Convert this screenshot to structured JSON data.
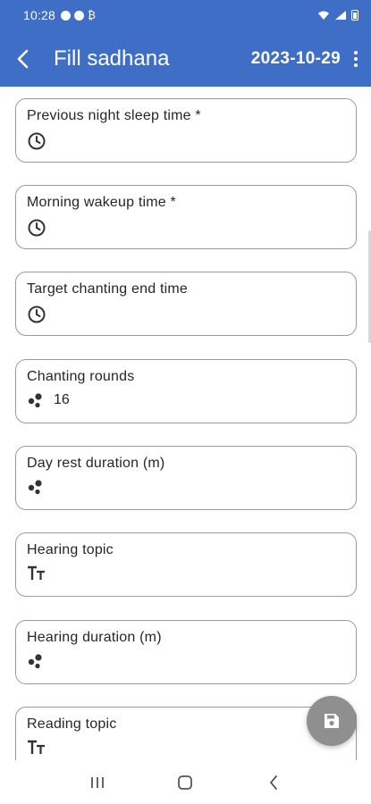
{
  "status_bar": {
    "time": "10:28"
  },
  "app_bar": {
    "title": "Fill sadhana",
    "date": "2023-10-29"
  },
  "fields": [
    {
      "label": "Previous night sleep time *",
      "icon": "clock-icon",
      "value": ""
    },
    {
      "label": "Morning wakeup time *",
      "icon": "clock-icon",
      "value": ""
    },
    {
      "label": "Target chanting end time",
      "icon": "clock-icon",
      "value": ""
    },
    {
      "label": "Chanting rounds",
      "icon": "number-dots-icon",
      "value": "16"
    },
    {
      "label": "Day rest duration (m)",
      "icon": "number-dots-icon",
      "value": ""
    },
    {
      "label": "Hearing topic",
      "icon": "text-format-icon",
      "value": ""
    },
    {
      "label": "Hearing duration (m)",
      "icon": "number-dots-icon",
      "value": ""
    },
    {
      "label": "Reading topic",
      "icon": "text-format-icon",
      "value": ""
    }
  ],
  "colors": {
    "app_bar": "#3f6ec6",
    "fab": "#8f8f8f",
    "field_border": "#9a9a9a"
  }
}
